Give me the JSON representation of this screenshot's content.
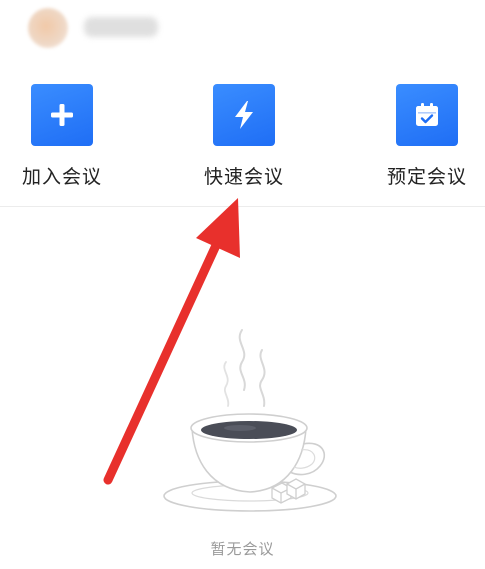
{
  "actions": {
    "join": {
      "label": "加入会议",
      "icon": "plus-icon"
    },
    "quick": {
      "label": "快速会议",
      "icon": "lightning-icon"
    },
    "schedule": {
      "label": "预定会议",
      "icon": "calendar-check-icon"
    }
  },
  "empty_state": {
    "text": "暂无会议",
    "icon": "coffee-cup-icon"
  },
  "colors": {
    "accent": "#1f6ef5",
    "annotation_arrow": "#e8302c",
    "muted_text": "#9a9a9a"
  }
}
